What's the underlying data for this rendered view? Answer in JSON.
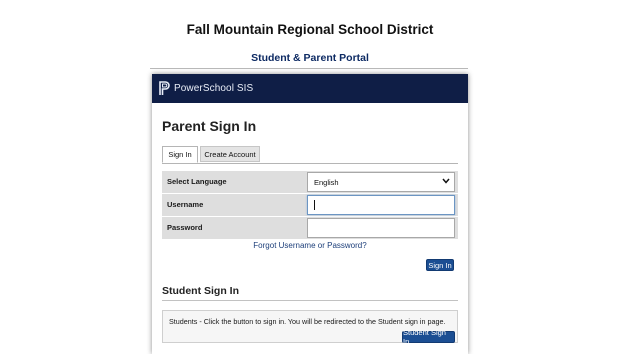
{
  "page": {
    "district_title": "Fall Mountain Regional School District",
    "portal_title": "Student & Parent Portal"
  },
  "header": {
    "brand": "PowerSchool SIS",
    "logo_icon": "powerschool-p-logo-icon"
  },
  "parent_signin": {
    "heading": "Parent Sign In",
    "tabs": [
      {
        "label": "Sign In",
        "active": true
      },
      {
        "label": "Create Account",
        "active": false
      }
    ],
    "fields": {
      "language": {
        "label": "Select Language",
        "value": "English"
      },
      "username": {
        "label": "Username",
        "value": ""
      },
      "password": {
        "label": "Password",
        "value": ""
      }
    },
    "forgot_link": "Forgot Username or Password?",
    "signin_button": "Sign In"
  },
  "student_signin": {
    "heading": "Student Sign In",
    "message": "Students - Click the button to sign in. You will be redirected to the Student sign in page.",
    "button": "Student Sign In"
  },
  "colors": {
    "header_bg": "#0f1e46",
    "button_bg": "#1b4e93",
    "link": "#1d3f7a",
    "row_bg": "#dedede"
  }
}
